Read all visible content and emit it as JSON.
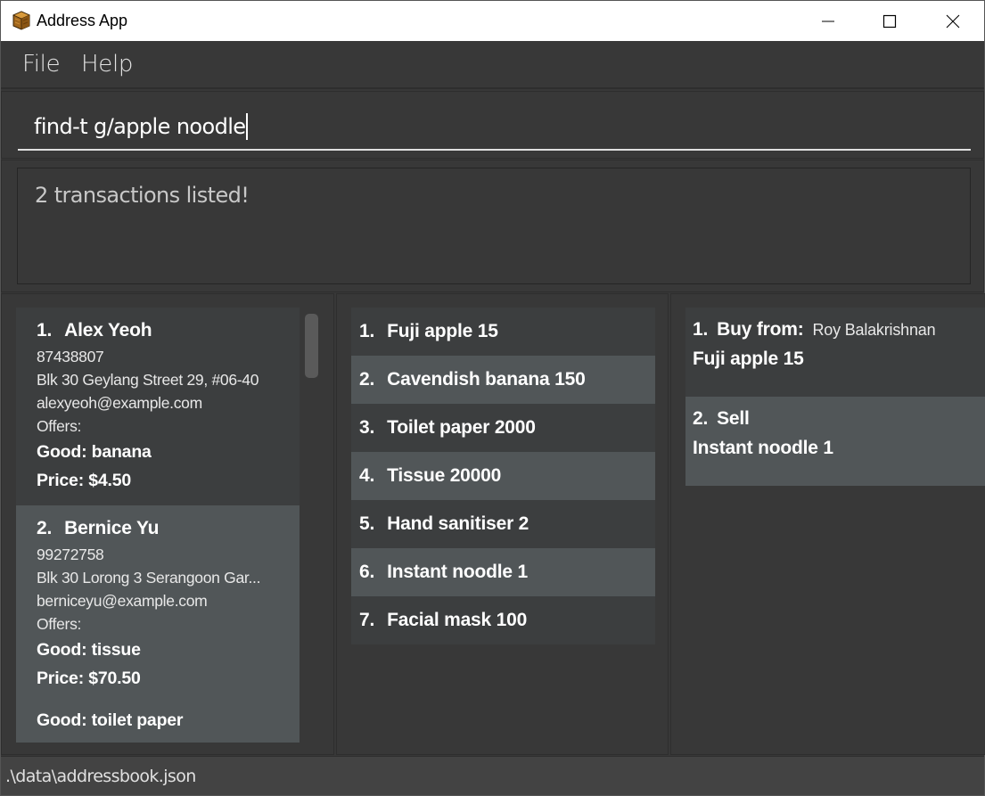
{
  "window": {
    "title": "Address App",
    "icon": "crate-icon",
    "controls": [
      "minimize-icon",
      "maximize-icon",
      "close-icon"
    ]
  },
  "menu": {
    "file_label": "File",
    "help_label": "Help"
  },
  "command": {
    "value": "find-t g/apple noodle"
  },
  "result": {
    "message": "2 transactions listed!"
  },
  "persons": [
    {
      "index": "1.",
      "name": "Alex Yeoh",
      "phone": "87438807",
      "address": "Blk 30 Geylang Street 29, #06-40",
      "email": "alexyeoh@example.com",
      "offers_label": "Offers:",
      "offers": [
        {
          "good": "Good: banana",
          "price": "Price: $4.50"
        }
      ]
    },
    {
      "index": "2.",
      "name": "Bernice Yu",
      "phone": "99272758",
      "address": "Blk 30 Lorong 3 Serangoon Gar...",
      "email": "berniceyu@example.com",
      "offers_label": "Offers:",
      "offers": [
        {
          "good": "Good: tissue",
          "price": "Price: $70.50"
        },
        {
          "good": "Good: toilet paper"
        }
      ]
    }
  ],
  "goods": [
    {
      "index": "1.",
      "label": "Fuji apple 15"
    },
    {
      "index": "2.",
      "label": "Cavendish banana 150"
    },
    {
      "index": "3.",
      "label": "Toilet paper 2000"
    },
    {
      "index": "4.",
      "label": "Tissue 20000"
    },
    {
      "index": "5.",
      "label": "Hand sanitiser 2"
    },
    {
      "index": "6.",
      "label": "Instant noodle 1"
    },
    {
      "index": "7.",
      "label": "Facial mask 100"
    }
  ],
  "transactions": [
    {
      "index": "1.",
      "type": "Buy from:",
      "party": "Roy Balakrishnan",
      "good": "Fuji apple 15"
    },
    {
      "index": "2.",
      "type": "Sell",
      "party": "",
      "good": "Instant noodle 1"
    }
  ],
  "status": {
    "file_path": ".\\data\\addressbook.json"
  }
}
